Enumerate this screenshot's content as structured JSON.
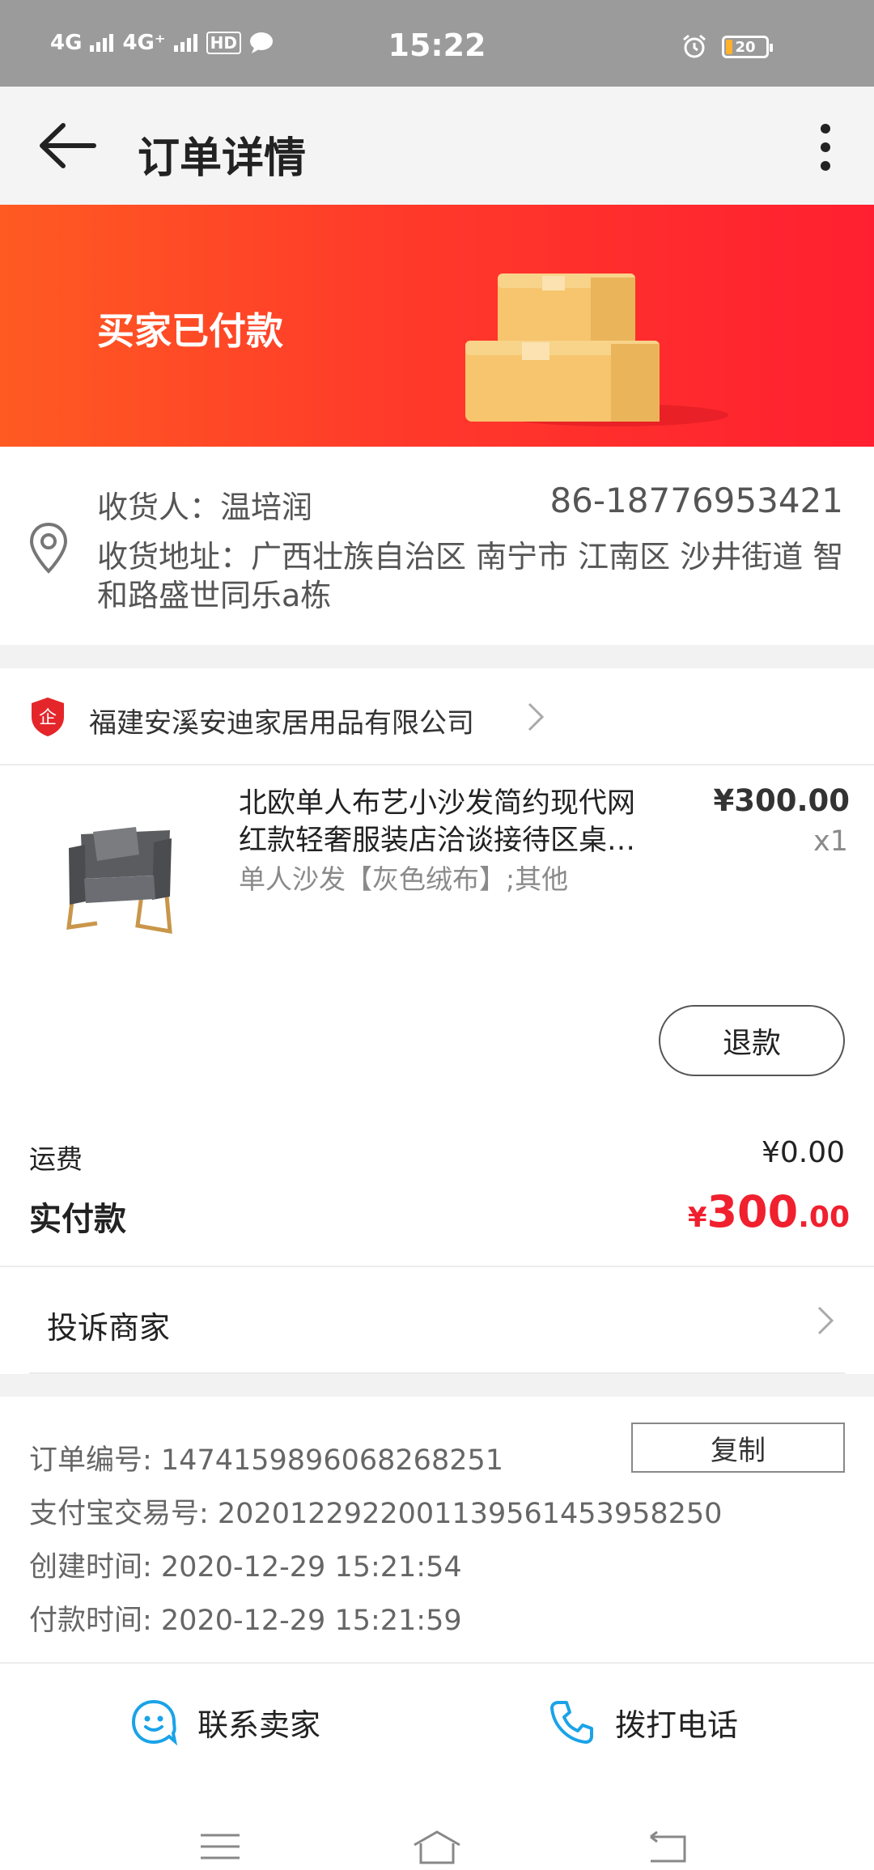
{
  "status_bar": {
    "network_1": "4G",
    "network_2": "4G⁺",
    "hd": "HD",
    "time": "15:22",
    "battery": "20"
  },
  "header": {
    "title": "订单详情"
  },
  "banner": {
    "status": "买家已付款"
  },
  "address": {
    "receiver": "收货人：温培润",
    "phone": "86-18776953421",
    "address": "收货地址：广西壮族自治区 南宁市 江南区 沙井街道 智和路盛世同乐a栋"
  },
  "store": {
    "badge": "企",
    "name": "福建安溪安迪家居用品有限公司"
  },
  "product": {
    "title_line1": "北欧单人布艺小沙发简约现代网",
    "title_line2": "红款轻奢服装店洽谈接待区桌…",
    "spec": "单人沙发【灰色绒布】;其他",
    "price": "¥300.00",
    "quantity": "x1",
    "refund_label": "退款"
  },
  "totals": {
    "shipping_label": "运费",
    "shipping_value": "¥0.00",
    "paid_label": "实付款",
    "paid_currency": "¥",
    "paid_integer": "300",
    "paid_decimal": ".00"
  },
  "complain": {
    "label": "投诉商家"
  },
  "order_info": {
    "order_no": "订单编号: 1474159896068268251",
    "copy_label": "复制",
    "alipay_no": "支付宝交易号: 2020122922001139561453958250",
    "created": "创建时间: 2020-12-29 15:21:54",
    "paid": "付款时间: 2020-12-29 15:21:59"
  },
  "actions": {
    "contact_seller": "联系卖家",
    "call_phone": "拨打电话"
  },
  "colors": {
    "accent_red": "#f0202e",
    "banner_start": "#ff5a22",
    "banner_end": "#ff1f30",
    "link_blue": "#1aa3e8"
  }
}
